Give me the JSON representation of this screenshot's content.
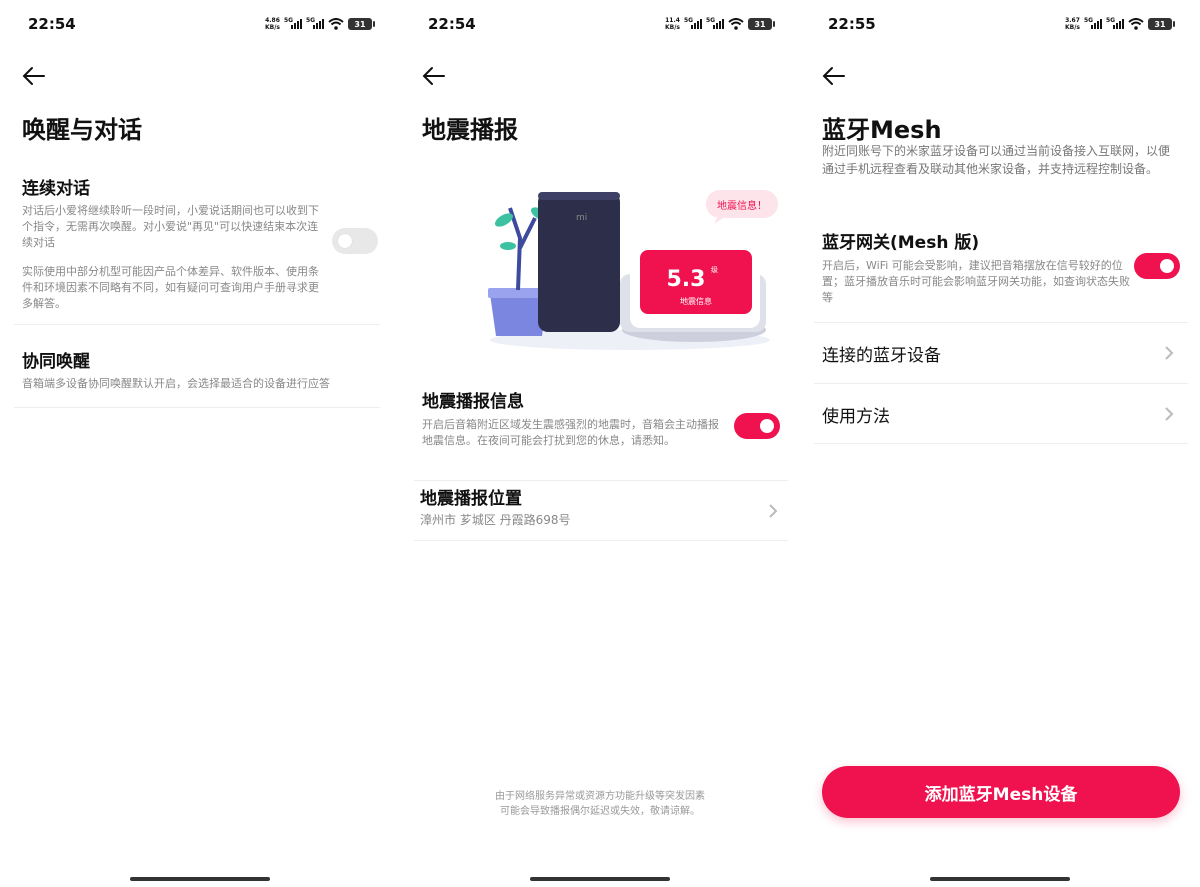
{
  "screens": [
    {
      "status": {
        "time": "22:54",
        "net_speed": "4.86",
        "net_unit": "KB/s",
        "net_type": "5G",
        "battery": "31"
      },
      "title": "唤醒与对话",
      "continuous": {
        "title": "连续对话",
        "desc": "对话后小爱将继续聆听一段时间，小爱说话期间也可以收到下个指令，无需再次唤醒。对小爱说\"再见\"可以快速结束本次连续对话",
        "note": "实际使用中部分机型可能因产品个体差异、软件版本、使用条件和环境因素不同略有不同，如有疑问可查询用户手册寻求更多解答。",
        "enabled": false
      },
      "cowake": {
        "title": "协同唤醒",
        "desc": "音箱端多设备协同唤醒默认开启，会选择最适合的设备进行应答"
      }
    },
    {
      "status": {
        "time": "22:54",
        "net_speed": "11.4",
        "net_unit": "KB/s",
        "net_type": "5G",
        "battery": "31"
      },
      "title": "地震播报",
      "illustration": {
        "bubble": "地震信息！",
        "magnitude": "5.3",
        "magnitude_unit": "级",
        "screen_caption": "地震信息",
        "logo": "mi"
      },
      "info": {
        "title": "地震播报信息",
        "desc": "开启后音箱附近区域发生震感强烈的地震时，音箱会主动播报地震信息。在夜间可能会打扰到您的休息，请悉知。",
        "enabled": true
      },
      "location": {
        "title": "地震播报位置",
        "value": "漳州市 芗城区 丹霞路698号"
      },
      "footer_line1": "由于网络服务异常或资源方功能升级等突发因素",
      "footer_line2": "可能会导致播报偶尔延迟或失效，敬请谅解。"
    },
    {
      "status": {
        "time": "22:55",
        "net_speed": "3.67",
        "net_unit": "KB/s",
        "net_type": "5G",
        "battery": "31"
      },
      "title": "蓝牙Mesh",
      "subtitle": "附近同账号下的米家蓝牙设备可以通过当前设备接入互联网，以便通过手机远程查看及联动其他米家设备，并支持远程控制设备。",
      "gateway": {
        "title": "蓝牙网关(Mesh 版)",
        "desc": "开启后，WiFi 可能会受影响，建议把音箱摆放在信号较好的位置；蓝牙播放音乐时可能会影响蓝牙网关功能，如查询状态失败等",
        "enabled": true
      },
      "connected": "连接的蓝牙设备",
      "howto": "使用方法",
      "cta": "添加蓝牙Mesh设备"
    }
  ],
  "colors": {
    "accent": "#f0124f",
    "text": "#111111",
    "muted": "#888888",
    "divider": "#eeeeee"
  },
  "icons": [
    "back-arrow-icon",
    "chevron-right-icon",
    "wifi-icon",
    "signal-icon",
    "battery-icon"
  ]
}
